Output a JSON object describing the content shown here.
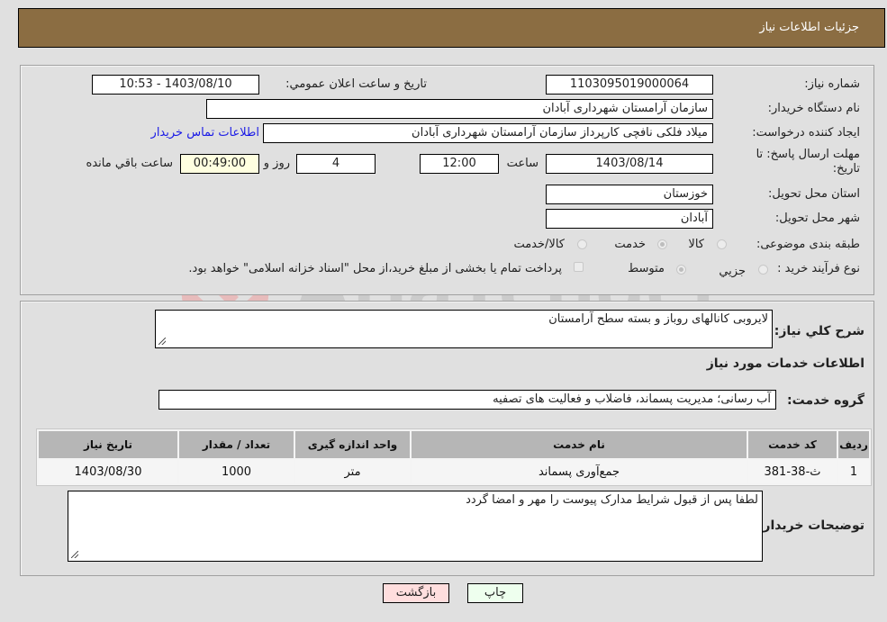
{
  "header": {
    "title": "جزئیات اطلاعات نیاز"
  },
  "fields": {
    "need_number_label": "شماره نیاز:",
    "need_number": "1103095019000064",
    "announce_label": "تاریخ و ساعت اعلان عمومي:",
    "announce_value": "1403/08/10 - 10:53",
    "buyer_org_label": "نام دستگاه خریدار:",
    "buyer_org": "سازمان آرامستان شهرداری آبادان",
    "creator_label": "ایجاد کننده درخواست:",
    "creator": "میلاد فلکی نافچی کارپرداز سازمان آرامستان شهرداری آبادان",
    "contact_link": "اطلاعات تماس خریدار",
    "deadline_label": "مهلت ارسال پاسخ: تا تاریخ:",
    "deadline_date": "1403/08/14",
    "time_label": "ساعت",
    "deadline_time": "12:00",
    "days_value": "4",
    "days_label": "روز و",
    "remaining_value": "00:49:00",
    "remaining_label": "ساعت باقي مانده",
    "province_label": "استان محل تحویل:",
    "province": "خوزستان",
    "city_label": "شهر محل تحویل:",
    "city": "آبادان",
    "category_label": "طبقه بندی موضوعی:",
    "category_options": [
      {
        "label": "کالا",
        "selected": false
      },
      {
        "label": "خدمت",
        "selected": true
      },
      {
        "label": "کالا/خدمت",
        "selected": false
      }
    ],
    "purchase_type_label": "نوع فرآیند خرید :",
    "purchase_type_options": [
      {
        "label": "جزيي",
        "selected": false
      },
      {
        "label": "متوسط",
        "selected": true
      }
    ],
    "treasury_note": "پرداخت تمام یا بخشی از مبلغ خرید،از محل \"اسناد خزانه اسلامی\" خواهد بود.",
    "treasury_checked": false
  },
  "details": {
    "summary_label": "شرح کلي نیاز:",
    "summary": "لایروبی کانالهای روباز و بسته سطح آرامستان",
    "services_heading": "اطلاعات خدمات مورد نیاز",
    "service_group_label": "گروه خدمت:",
    "service_group": "آب رسانی؛ مدیریت پسماند، فاضلاب و فعالیت های تصفیه",
    "table": {
      "headers": [
        "ردیف",
        "کد خدمت",
        "نام خدمت",
        "واحد اندازه گیری",
        "تعداد / مقدار",
        "تاریخ نیاز"
      ],
      "rows": [
        [
          "1",
          "ث-38-381",
          "جمع‌آوری پسماند",
          "متر",
          "1000",
          "1403/08/30"
        ]
      ]
    },
    "buyer_notes_label": "توضیحات خریدار:",
    "buyer_notes": "لطفا پس از قبول شرایط مدارک پیوست را مهر و امضا گردد"
  },
  "buttons": {
    "print": "چاپ",
    "back": "بازگشت"
  },
  "colors": {
    "header_bg": "#8b6d42",
    "print_bg": "#eeffee",
    "back_bg": "#ffdede",
    "remaining_bg": "#ffffe0",
    "link": "#1a1ae6"
  },
  "watermark": {
    "text": "AriaTender.neT"
  }
}
